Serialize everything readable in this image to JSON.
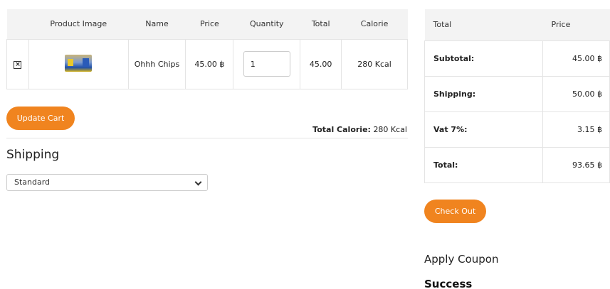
{
  "cart": {
    "headers": [
      "",
      "Product Image",
      "Name",
      "Price",
      "Quantity",
      "Total",
      "Calorie"
    ],
    "items": [
      {
        "name": "Ohhh Chips",
        "price": "45.00 ฿",
        "quantity": "1",
        "total": "45.00",
        "calorie": "280 Kcal"
      }
    ],
    "remove_icon": "close-box-icon",
    "product_image": "chips-product-image"
  },
  "update_cart_label": "Update Cart",
  "total_calorie": {
    "label": "Total Calorie:",
    "value": "280 Kcal"
  },
  "shipping": {
    "title": "Shipping",
    "selected": "Standard",
    "options": [
      "Standard"
    ]
  },
  "summary": {
    "headers": [
      "Total",
      "Price"
    ],
    "rows": [
      {
        "label": "Subtotal:",
        "value": "45.00 ฿"
      },
      {
        "label": "Shipping:",
        "value": "50.00 ฿"
      },
      {
        "label": "Vat 7%:",
        "value": "3.15 ฿"
      },
      {
        "label": "Total:",
        "value": "93.65 ฿"
      }
    ]
  },
  "checkout_label": "Check Out",
  "coupon": {
    "title": "Apply Coupon",
    "status": "Success"
  },
  "colors": {
    "accent": "#f0841f",
    "header_bg": "#f3f3f3",
    "border": "#e4e4e4"
  }
}
